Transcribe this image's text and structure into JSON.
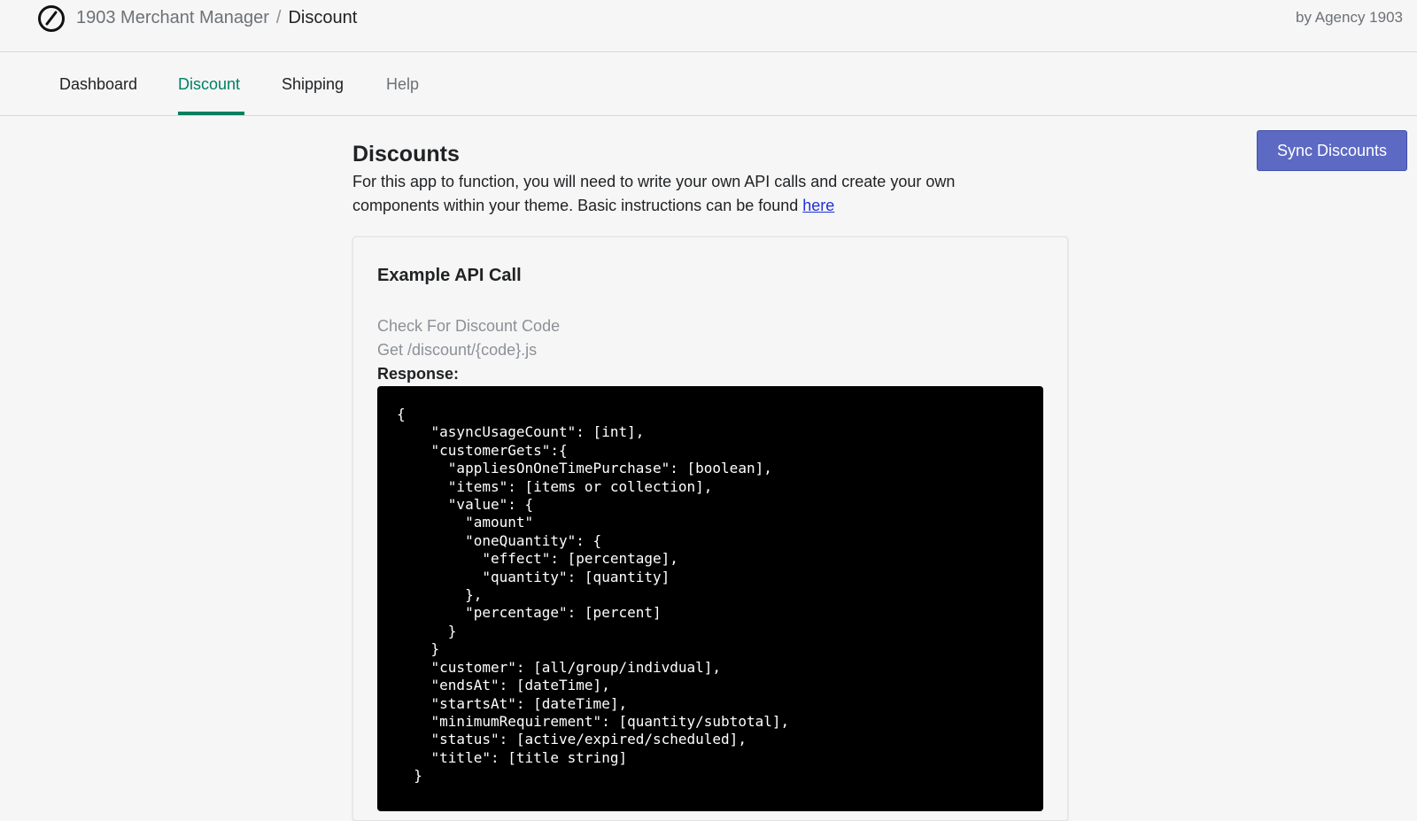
{
  "header": {
    "app_name": "1903 Merchant Manager",
    "separator": "/",
    "current_page": "Discount",
    "byline": "by Agency 1903",
    "logo_icon": "compass-icon"
  },
  "nav": {
    "tabs": [
      {
        "label": "Dashboard",
        "active": false
      },
      {
        "label": "Discount",
        "active": true
      },
      {
        "label": "Shipping",
        "active": false
      },
      {
        "label": "Help",
        "active": false
      }
    ]
  },
  "main": {
    "title": "Discounts",
    "description": "For this app to function, you will need to write your own API calls and create your own components within your theme. Basic instructions can be found ",
    "link_text": "here",
    "sync_button_label": "Sync Discounts"
  },
  "card": {
    "title": "Example API Call",
    "subtitle": "Check For Discount Code",
    "endpoint": "Get /discount/{code}.js",
    "response_label": "Response:",
    "code": "{\n    \"asyncUsageCount\": [int],\n    \"customerGets\":{\n      \"appliesOnOneTimePurchase\": [boolean],\n      \"items\": [items or collection],\n      \"value\": {\n        \"amount\"\n        \"oneQuantity\": {\n          \"effect\": [percentage],\n          \"quantity\": [quantity]\n        },\n        \"percentage\": [percent]\n      }\n    }\n    \"customer\": [all/group/indivdual],\n    \"endsAt\": [dateTime],\n    \"startsAt\": [dateTime],\n    \"minimumRequirement\": [quantity/subtotal],\n    \"status\": [active/expired/scheduled],\n    \"title\": [title string]\n  }"
  },
  "colors": {
    "accent_green": "#008060",
    "button_indigo": "#5c6ac4",
    "code_background": "#000000",
    "page_background": "#f6f6f7"
  }
}
